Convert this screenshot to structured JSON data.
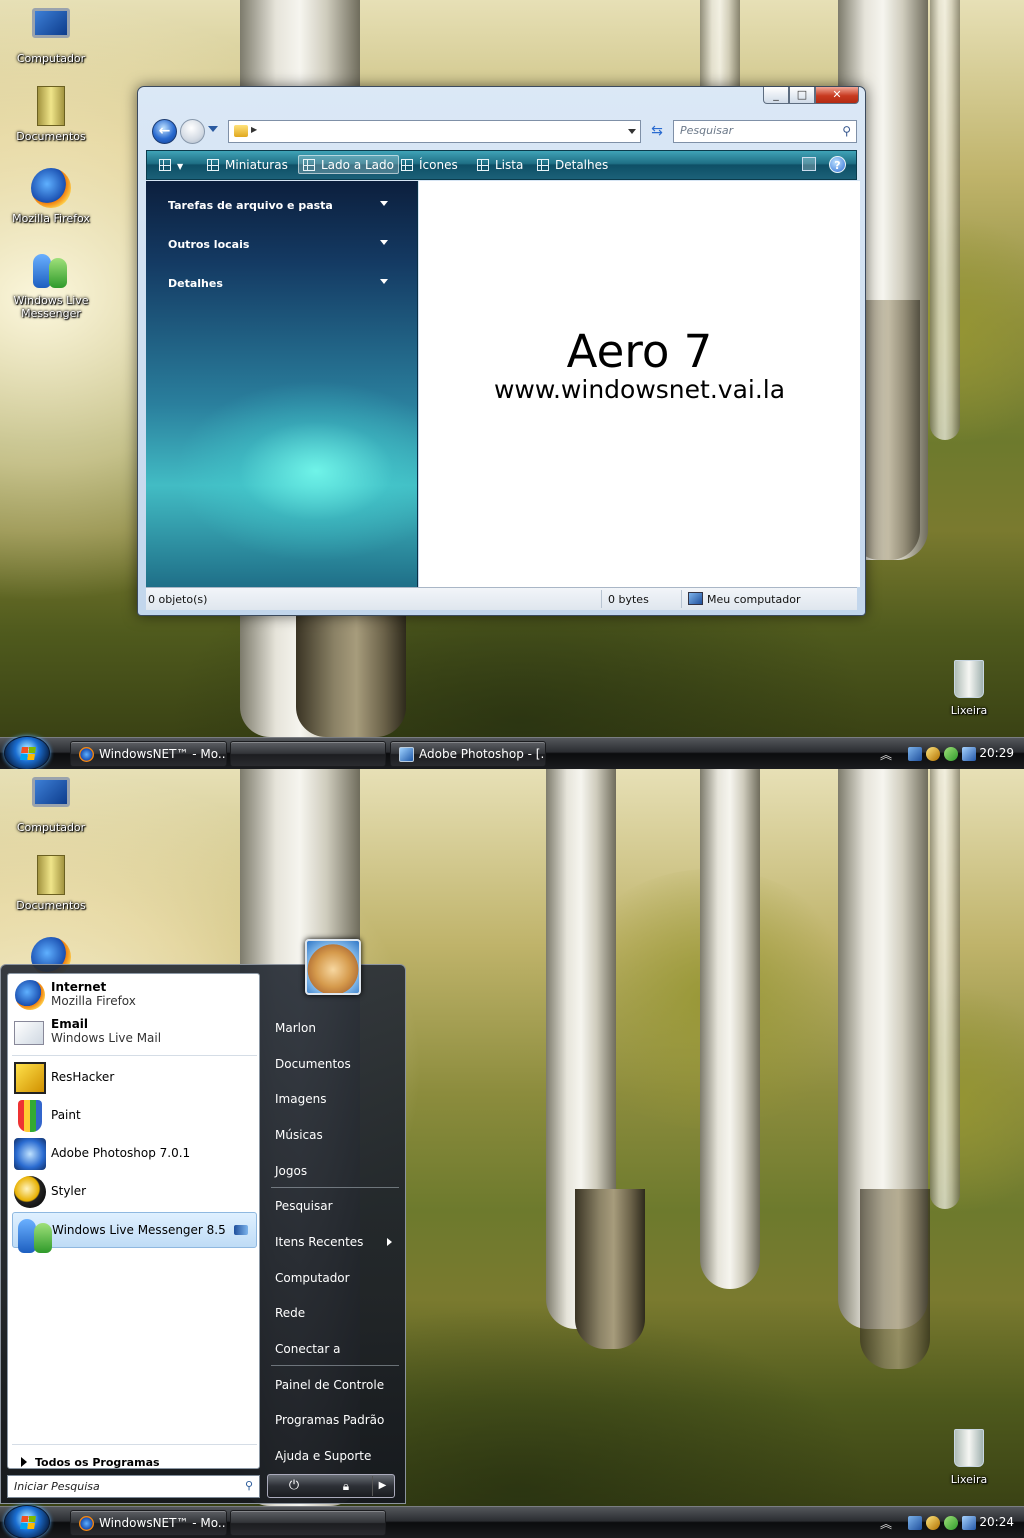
{
  "desktop_icons": [
    {
      "label": "Computador",
      "icon": "computer-icon"
    },
    {
      "label": "Documentos",
      "icon": "documents-icon"
    },
    {
      "label": "Mozilla Firefox",
      "icon": "firefox-icon"
    },
    {
      "label": "Windows Live Messenger",
      "icon": "messenger-icon"
    }
  ],
  "recycle_bin": {
    "label": "Lixeira",
    "icon": "recycle-bin-icon"
  },
  "explorer": {
    "search_placeholder": "Pesquisar",
    "toolbar": {
      "miniaturas": "Miniaturas",
      "lado_a_lado": "Lado a Lado",
      "icones": "Ícones",
      "lista": "Lista",
      "detalhes": "Detalhes"
    },
    "task_sections": [
      "Tarefas de arquivo e pasta",
      "Outros locais",
      "Detalhes"
    ],
    "watermark_title": "Aero 7",
    "watermark_url": "www.windowsnet.vai.la",
    "status": {
      "objects": "0 objeto(s)",
      "size": "0 bytes",
      "location": "Meu computador"
    }
  },
  "taskbar_top": {
    "buttons": [
      "WindowsNET™ - Mo...",
      "",
      "Adobe Photoshop - [..."
    ],
    "clock": "20:29"
  },
  "taskbar_bottom": {
    "buttons": [
      "WindowsNET™ - Mo...",
      ""
    ],
    "clock": "20:24"
  },
  "start_menu": {
    "pinned": [
      {
        "title": "Internet",
        "subtitle": "Mozilla Firefox",
        "icon": "firefox-icon"
      },
      {
        "title": "Email",
        "subtitle": "Windows Live Mail",
        "icon": "mail-icon"
      }
    ],
    "recent": [
      {
        "label": "ResHacker",
        "icon": "reshacker-icon"
      },
      {
        "label": "Paint",
        "icon": "paint-icon"
      },
      {
        "label": "Adobe Photoshop 7.0.1",
        "icon": "photoshop-icon"
      },
      {
        "label": "Styler",
        "icon": "styler-icon"
      },
      {
        "label": "Windows Live Messenger 8.5",
        "icon": "messenger-icon"
      }
    ],
    "all_programs": "Todos os Programas",
    "search_placeholder": "Iniciar Pesquisa",
    "right_items": [
      "Marlon",
      "Documentos",
      "Imagens",
      "Músicas",
      "Jogos",
      "Pesquisar",
      "Itens Recentes",
      "Computador",
      "Rede",
      "Conectar a",
      "Painel de Controle",
      "Programas Padrão",
      "Ajuda e Suporte"
    ]
  }
}
